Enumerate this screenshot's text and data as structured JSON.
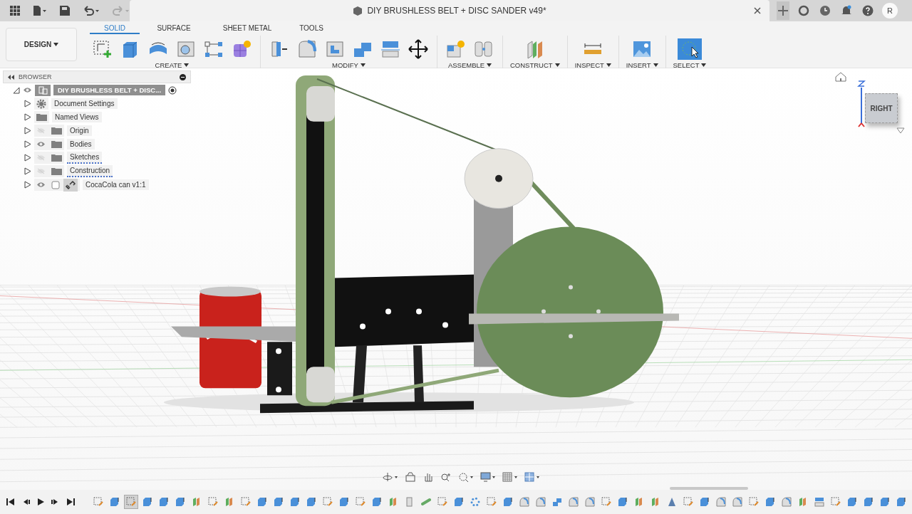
{
  "app_bar": {
    "document_title": "DIY BRUSHLESS BELT + DISC SANDER v49*",
    "avatar": "R"
  },
  "workspace": {
    "label": "DESIGN"
  },
  "tabs": [
    {
      "label": "SOLID",
      "selected": true
    },
    {
      "label": "SURFACE",
      "selected": false
    },
    {
      "label": "SHEET METAL",
      "selected": false
    },
    {
      "label": "TOOLS",
      "selected": false
    }
  ],
  "tool_groups": [
    {
      "label": "CREATE",
      "tools": [
        {
          "kind": "sketch"
        },
        {
          "kind": "extrude"
        },
        {
          "kind": "revolve"
        },
        {
          "kind": "hole"
        },
        {
          "kind": "pattern"
        },
        {
          "kind": "form"
        }
      ]
    },
    {
      "label": "MODIFY",
      "tools": [
        {
          "kind": "presspull"
        },
        {
          "kind": "fillet"
        },
        {
          "kind": "shell"
        },
        {
          "kind": "combine"
        },
        {
          "kind": "split"
        },
        {
          "kind": "move"
        }
      ]
    },
    {
      "label": "ASSEMBLE",
      "tools": [
        {
          "kind": "component"
        },
        {
          "kind": "joint"
        }
      ]
    },
    {
      "label": "CONSTRUCT",
      "tools": [
        {
          "kind": "plane"
        }
      ]
    },
    {
      "label": "INSPECT",
      "tools": [
        {
          "kind": "measure"
        }
      ]
    },
    {
      "label": "INSERT",
      "tools": [
        {
          "kind": "image"
        }
      ]
    },
    {
      "label": "SELECT",
      "tools": [
        {
          "kind": "select"
        }
      ]
    }
  ],
  "browser": {
    "title": "BROWSER",
    "root": {
      "label": "DIY BRUSHLESS BELT + DISC...",
      "visible": true,
      "expanded": true,
      "children": [
        {
          "label": "Document Settings",
          "kind": "gear",
          "flagged": false
        },
        {
          "label": "Named Views",
          "kind": "folder",
          "flagged": false
        },
        {
          "label": "Origin",
          "kind": "folder",
          "visible": false,
          "flagged": false
        },
        {
          "label": "Bodies",
          "kind": "folder",
          "visible": true,
          "flagged": false
        },
        {
          "label": "Sketches",
          "kind": "folder",
          "visible": false,
          "flagged": true
        },
        {
          "label": "Construction",
          "kind": "folder",
          "visible": false,
          "flagged": true
        },
        {
          "label": "CocaCola can v1:1",
          "kind": "link",
          "visible": true,
          "flagged": false
        }
      ]
    }
  },
  "viewcube": {
    "face": "RIGHT"
  },
  "timeline": [
    {
      "kind": "sketch",
      "selected": false
    },
    {
      "kind": "extrude",
      "selected": false
    },
    {
      "kind": "sketch",
      "selected": true
    },
    {
      "kind": "extrude",
      "selected": false
    },
    {
      "kind": "extrude",
      "selected": false
    },
    {
      "kind": "extrude",
      "selected": false
    },
    {
      "kind": "plane",
      "selected": false
    },
    {
      "kind": "sketch",
      "selected": false
    },
    {
      "kind": "plane",
      "selected": false
    },
    {
      "kind": "sketch",
      "selected": false
    },
    {
      "kind": "extrude",
      "selected": false
    },
    {
      "kind": "extrude",
      "selected": false
    },
    {
      "kind": "extrude",
      "selected": false
    },
    {
      "kind": "extrude",
      "selected": false
    },
    {
      "kind": "sketch",
      "selected": false
    },
    {
      "kind": "extrude",
      "selected": false
    },
    {
      "kind": "sketch",
      "selected": false
    },
    {
      "kind": "extrude",
      "selected": false
    },
    {
      "kind": "plane",
      "selected": false
    },
    {
      "kind": "joint",
      "selected": false
    },
    {
      "kind": "link",
      "selected": false
    },
    {
      "kind": "sketch",
      "selected": false
    },
    {
      "kind": "extrude",
      "selected": false
    },
    {
      "kind": "pattern",
      "selected": false
    },
    {
      "kind": "sketch",
      "selected": false
    },
    {
      "kind": "extrude",
      "selected": false
    },
    {
      "kind": "fillet",
      "selected": false
    },
    {
      "kind": "fillet",
      "selected": false
    },
    {
      "kind": "combine",
      "selected": false
    },
    {
      "kind": "fillet",
      "selected": false
    },
    {
      "kind": "fillet",
      "selected": false
    },
    {
      "kind": "sketch",
      "selected": false
    },
    {
      "kind": "extrude",
      "selected": false
    },
    {
      "kind": "plane",
      "selected": false
    },
    {
      "kind": "plane",
      "selected": false
    },
    {
      "kind": "mirror",
      "selected": false
    },
    {
      "kind": "sketch",
      "selected": false
    },
    {
      "kind": "extrude",
      "selected": false
    },
    {
      "kind": "fillet",
      "selected": false
    },
    {
      "kind": "fillet",
      "selected": false
    },
    {
      "kind": "sketch",
      "selected": false
    },
    {
      "kind": "extrude",
      "selected": false
    },
    {
      "kind": "fillet",
      "selected": false
    },
    {
      "kind": "plane",
      "selected": false
    },
    {
      "kind": "split",
      "selected": false
    },
    {
      "kind": "sketch",
      "selected": false
    },
    {
      "kind": "extrude",
      "selected": false
    },
    {
      "kind": "extrude",
      "selected": false
    },
    {
      "kind": "extrude",
      "selected": false
    },
    {
      "kind": "extrude",
      "selected": false
    }
  ]
}
